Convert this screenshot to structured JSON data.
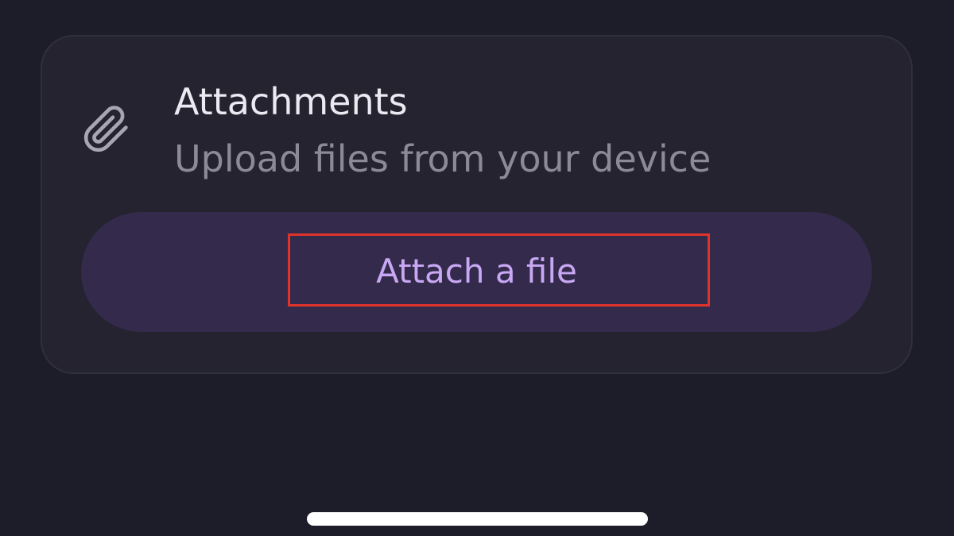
{
  "attachments_card": {
    "icon": "paperclip-icon",
    "title": "Attachments",
    "subtitle": "Upload files from your device",
    "button_label": "Attach a file"
  },
  "annotation": {
    "highlight_color": "#e0332c",
    "highlighted_element": "attach-button-label"
  },
  "colors": {
    "background": "#1d1c29",
    "card": "#24232f",
    "button": "#332a4c",
    "button_text": "#c9a8f3"
  }
}
